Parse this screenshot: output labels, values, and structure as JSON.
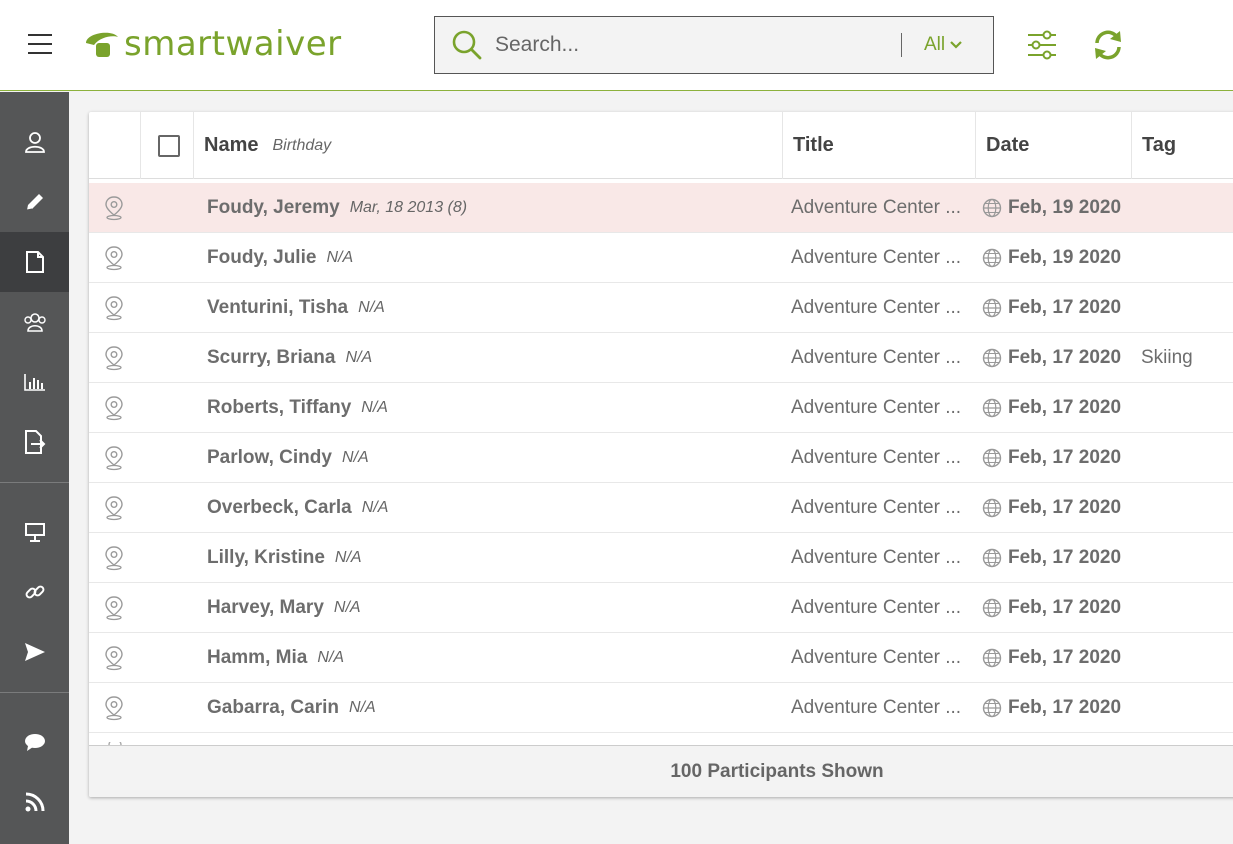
{
  "app": {
    "brand": "smartwaiver",
    "brand_color": "#7aa32c"
  },
  "header": {
    "menu_icon": "hamburger-icon",
    "search": {
      "placeholder": "Search...",
      "value": "",
      "filter_label": "All"
    },
    "filter_icon": "sliders-icon",
    "refresh_icon": "refresh-icon"
  },
  "sidebar": {
    "items": [
      {
        "icon": "user-icon",
        "active": false
      },
      {
        "icon": "pencil-icon",
        "active": false
      },
      {
        "icon": "document-icon",
        "active": true
      },
      {
        "icon": "group-icon",
        "active": false
      },
      {
        "icon": "bar-chart-icon",
        "active": false
      },
      {
        "icon": "export-icon",
        "active": false
      },
      {
        "icon": "kiosk-icon",
        "active": false
      },
      {
        "icon": "link-icon",
        "active": false
      },
      {
        "icon": "send-icon",
        "active": false
      },
      {
        "icon": "chat-icon",
        "active": false
      },
      {
        "icon": "rss-icon",
        "active": false
      }
    ]
  },
  "table": {
    "columns": {
      "name": "Name",
      "birthday": "Birthday",
      "title": "Title",
      "date": "Date",
      "tag": "Tag"
    },
    "rows": [
      {
        "name": "Foudy, Jeremy",
        "birthday": "Mar, 18 2013 (8)",
        "title": "Adventure Center ...",
        "date": "Feb, 19 2020",
        "tag": "",
        "highlight": true
      },
      {
        "name": "Foudy, Julie",
        "birthday": "N/A",
        "title": "Adventure Center ...",
        "date": "Feb, 19 2020",
        "tag": ""
      },
      {
        "name": "Venturini, Tisha",
        "birthday": "N/A",
        "title": "Adventure Center ...",
        "date": "Feb, 17 2020",
        "tag": ""
      },
      {
        "name": "Scurry, Briana",
        "birthday": "N/A",
        "title": "Adventure Center ...",
        "date": "Feb, 17 2020",
        "tag": "Skiing"
      },
      {
        "name": "Roberts, Tiffany",
        "birthday": "N/A",
        "title": "Adventure Center ...",
        "date": "Feb, 17 2020",
        "tag": ""
      },
      {
        "name": "Parlow, Cindy",
        "birthday": "N/A",
        "title": "Adventure Center ...",
        "date": "Feb, 17 2020",
        "tag": ""
      },
      {
        "name": "Overbeck, Carla",
        "birthday": "N/A",
        "title": "Adventure Center ...",
        "date": "Feb, 17 2020",
        "tag": ""
      },
      {
        "name": "Lilly, Kristine",
        "birthday": "N/A",
        "title": "Adventure Center ...",
        "date": "Feb, 17 2020",
        "tag": ""
      },
      {
        "name": "Harvey, Mary",
        "birthday": "N/A",
        "title": "Adventure Center ...",
        "date": "Feb, 17 2020",
        "tag": ""
      },
      {
        "name": "Hamm, Mia",
        "birthday": "N/A",
        "title": "Adventure Center ...",
        "date": "Feb, 17 2020",
        "tag": ""
      },
      {
        "name": "Gabarra, Carin",
        "birthday": "N/A",
        "title": "Adventure Center ...",
        "date": "Feb, 17 2020",
        "tag": ""
      }
    ],
    "footer": "100 Participants Shown"
  }
}
